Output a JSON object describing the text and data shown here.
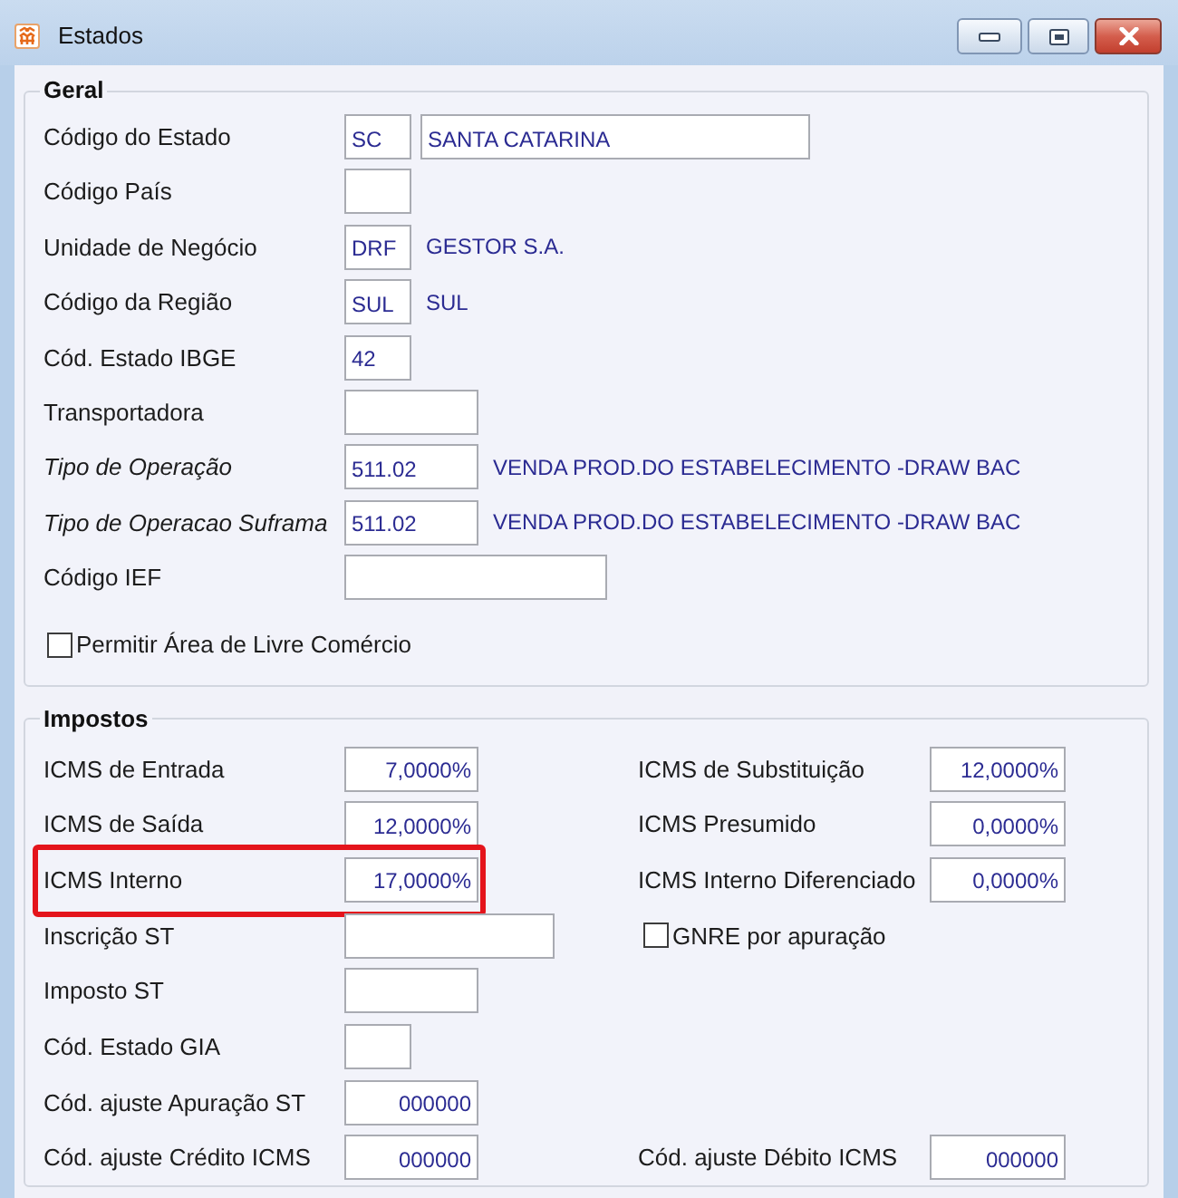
{
  "window": {
    "title": "Estados"
  },
  "general_section": {
    "title": "Geral",
    "rows": [
      {
        "kind": "field",
        "label": "Código do Estado",
        "emphasized": false,
        "value": "SC",
        "value_2": "SANTA CATARINA"
      },
      {
        "kind": "field",
        "label": "Código País",
        "emphasized": false
      },
      {
        "kind": "field",
        "label": "Unidade de Negócio",
        "emphasized": false,
        "value": "DRF",
        "description": "GESTOR S.A."
      },
      {
        "kind": "field",
        "label": "Código da Região",
        "emphasized": false,
        "value": "SUL",
        "description": "SUL"
      },
      {
        "kind": "field",
        "label": "Cód. Estado IBGE",
        "emphasized": false,
        "value": "42"
      },
      {
        "kind": "field",
        "label": "Transportadora",
        "emphasized": false
      },
      {
        "kind": "field",
        "label": "Tipo de Operação",
        "emphasized": true,
        "value": "511.02",
        "description": "VENDA PROD.DO ESTABELECIMENTO -DRAW BAC"
      },
      {
        "kind": "field",
        "label": "Tipo de Operacao Suframa",
        "emphasized": true,
        "value": "511.02",
        "description": "VENDA PROD.DO ESTABELECIMENTO -DRAW BAC"
      },
      {
        "kind": "field",
        "label": "Código IEF",
        "emphasized": false
      },
      {
        "kind": "checkbox",
        "label": "Permitir Área de Livre Comércio",
        "checked": false
      }
    ]
  },
  "tax_section": {
    "title": "Impostos",
    "rows": [
      {
        "left": {
          "kind": "field",
          "label": "ICMS de Entrada",
          "value": "7,0000%",
          "highlighted": false
        },
        "right": {
          "kind": "field",
          "label": "ICMS de Substituição",
          "value": "12,0000%"
        }
      },
      {
        "left": {
          "kind": "field",
          "label": "ICMS de Saída",
          "value": "12,0000%",
          "highlighted": false
        },
        "right": {
          "kind": "field",
          "label": "ICMS Presumido",
          "value": "0,0000%"
        }
      },
      {
        "left": {
          "kind": "field",
          "label": "ICMS Interno",
          "value": "17,0000%",
          "highlighted": true
        },
        "right": {
          "kind": "field",
          "label": "ICMS Interno Diferenciado",
          "value": "0,0000%"
        }
      },
      {
        "left": {
          "kind": "field",
          "label": "Inscrição ST",
          "highlighted": false
        },
        "right": {
          "kind": "checkbox",
          "label": "GNRE por apuração",
          "checked": false
        }
      },
      {
        "left": {
          "kind": "field",
          "label": "Imposto ST",
          "highlighted": false
        }
      },
      {
        "left": {
          "kind": "field",
          "label": "Cód. Estado GIA",
          "highlighted": false
        }
      },
      {
        "left": {
          "kind": "field",
          "label": "Cód. ajuste Apuração ST",
          "value": "000000",
          "highlighted": false
        }
      },
      {
        "left": {
          "kind": "field",
          "label": "Cód. ajuste Crédito ICMS",
          "value": "000000",
          "highlighted": false
        },
        "right": {
          "kind": "field",
          "label": "Cód. ajuste Débito ICMS",
          "value": "000000"
        }
      }
    ]
  }
}
